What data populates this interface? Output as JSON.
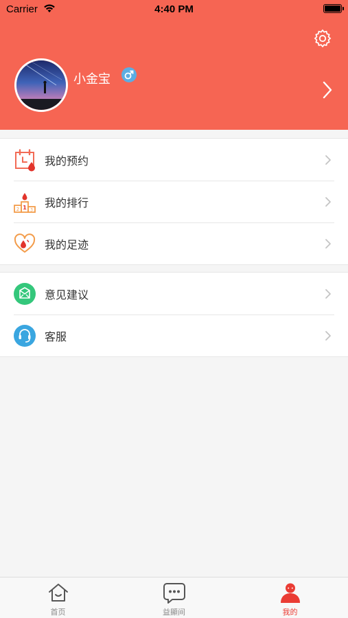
{
  "status_bar": {
    "carrier": "Carrier",
    "time": "4:40 PM"
  },
  "profile": {
    "username": "小金宝",
    "gender": "male"
  },
  "menu_group_1": [
    {
      "label": "我的预约",
      "icon": "calendar-icon"
    },
    {
      "label": "我的排行",
      "icon": "podium-icon"
    },
    {
      "label": "我的足迹",
      "icon": "heart-drop-icon"
    }
  ],
  "menu_group_2": [
    {
      "label": "意见建议",
      "icon": "mail-icon"
    },
    {
      "label": "客服",
      "icon": "headset-icon"
    }
  ],
  "tab_bar": {
    "tabs": [
      {
        "label": "首页",
        "icon": "home-icon"
      },
      {
        "label": "益顯间",
        "icon": "chat-icon"
      },
      {
        "label": "我的",
        "icon": "user-icon"
      }
    ],
    "active_index": 2
  },
  "colors": {
    "header": "#f66553",
    "accent_red": "#ea3c34",
    "green": "#34c77b",
    "blue": "#3aa6e0",
    "orange": "#f39c4a"
  }
}
